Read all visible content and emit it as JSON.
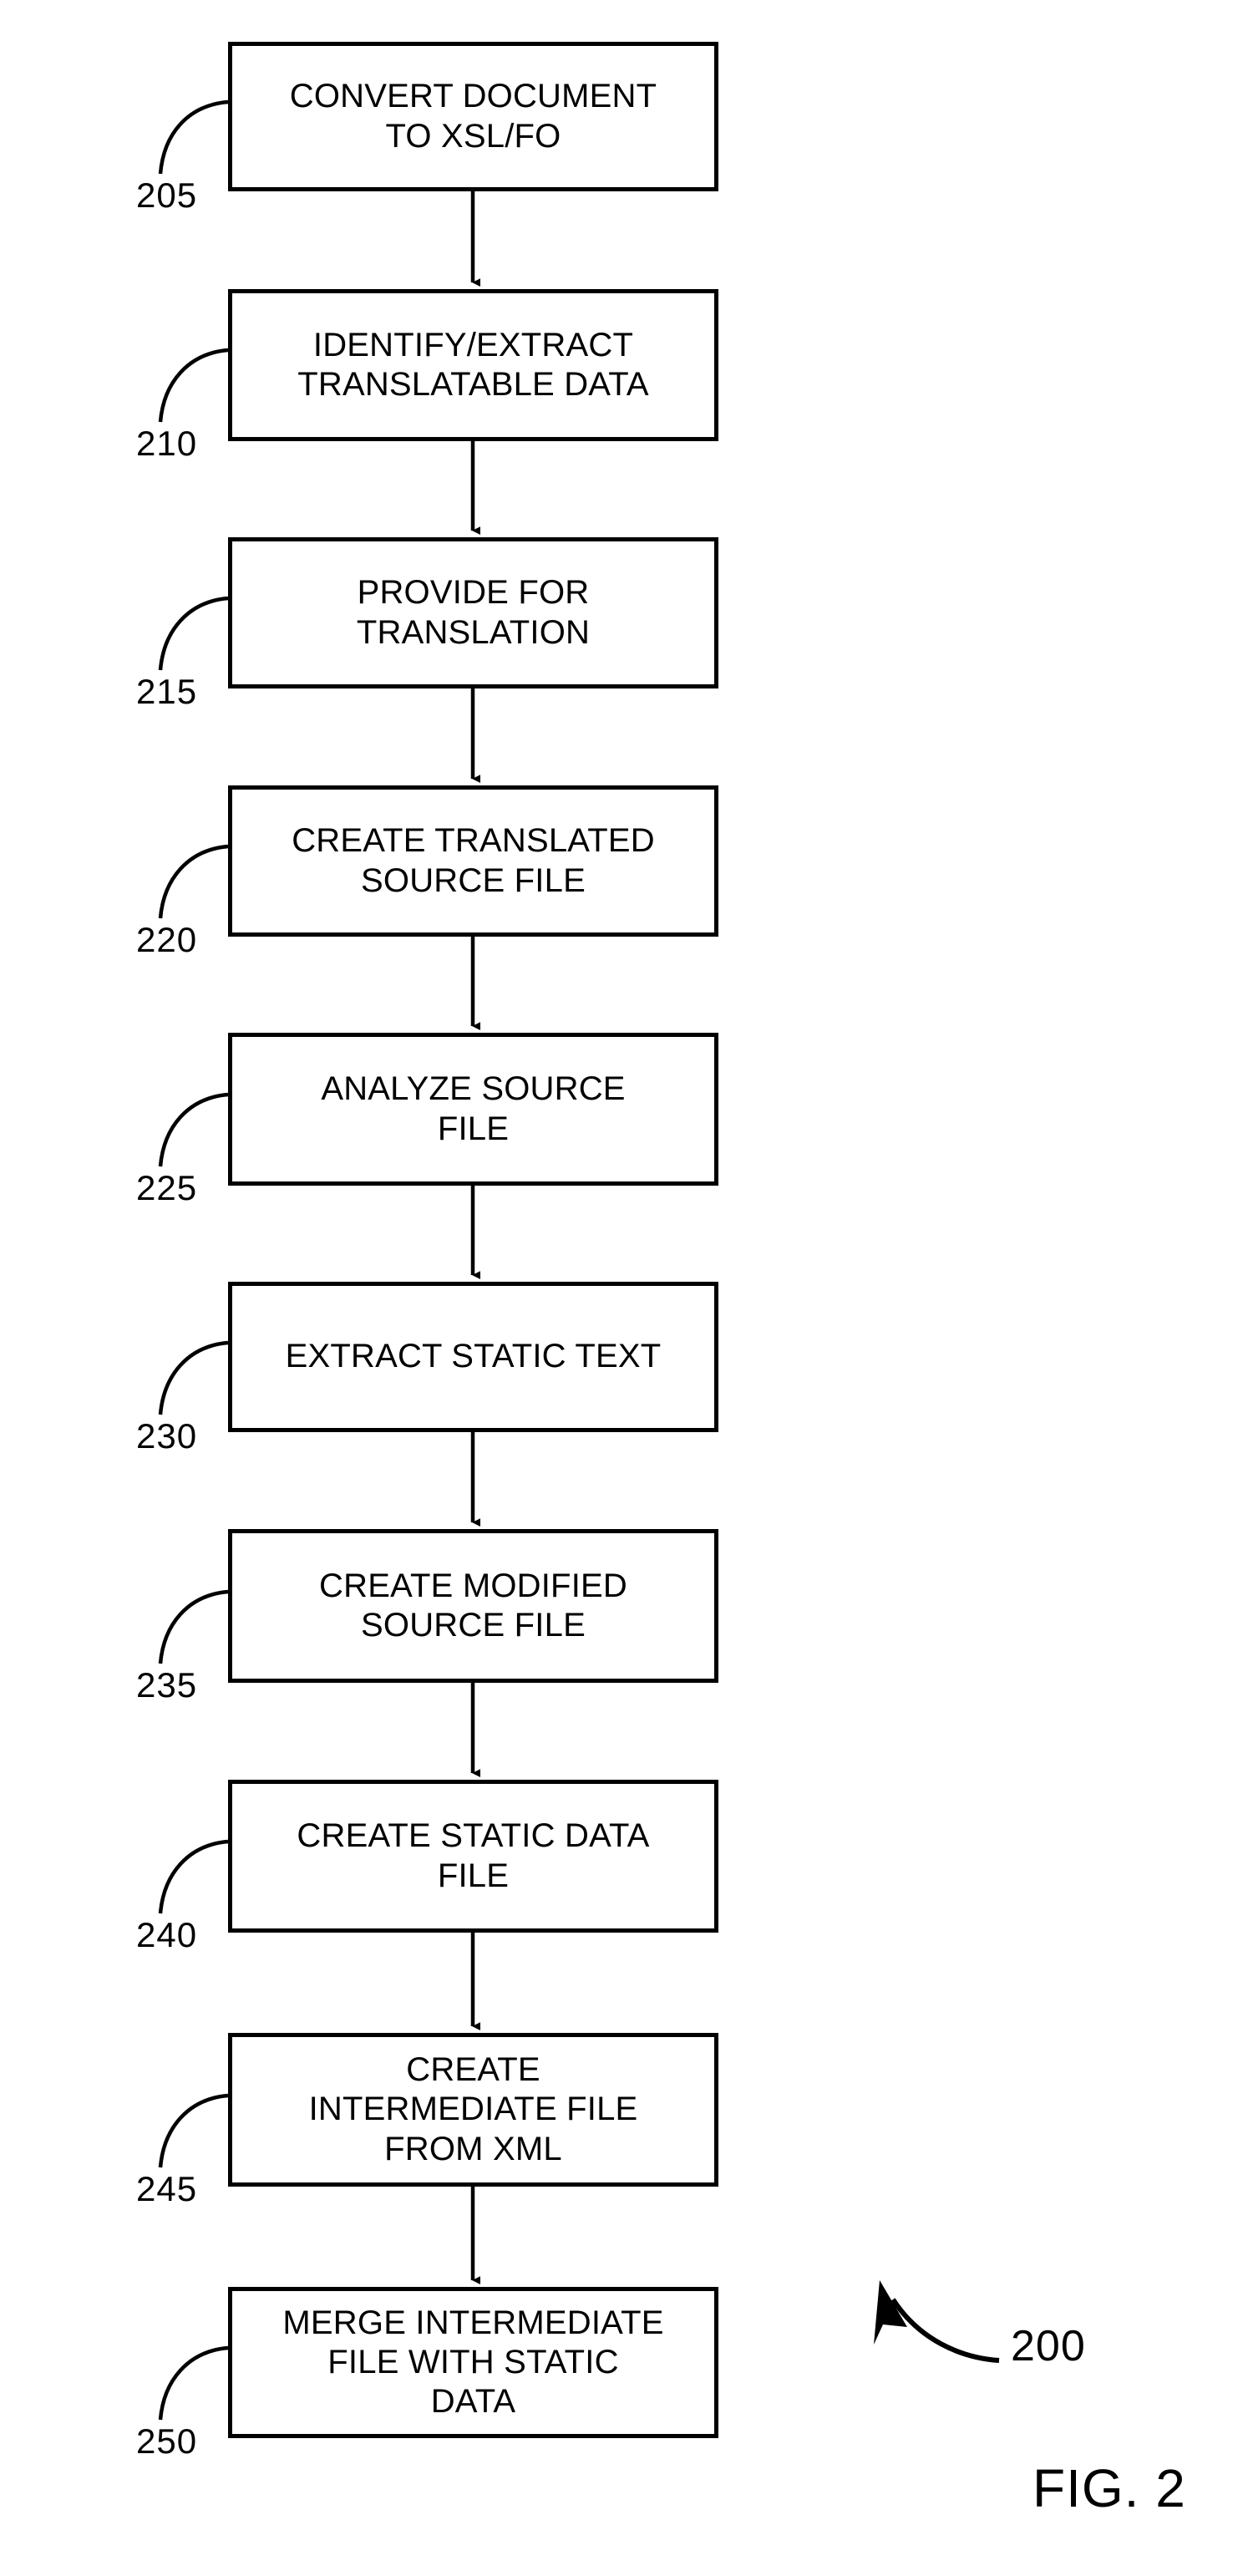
{
  "figure": {
    "caption": "FIG. 2",
    "diagram_ref": "200",
    "type": "patent-flowchart",
    "orientation": "vertical-top-to-bottom",
    "line_color": "#000000",
    "background_color": "#ffffff"
  },
  "steps": [
    {
      "ref": "205",
      "lines": [
        "CONVERT DOCUMENT",
        "TO XSL/FO"
      ],
      "text": "CONVERT DOCUMENT TO XSL/FO"
    },
    {
      "ref": "210",
      "lines": [
        "IDENTIFY/EXTRACT",
        "TRANSLATABLE DATA"
      ],
      "text": "IDENTIFY/EXTRACT TRANSLATABLE DATA"
    },
    {
      "ref": "215",
      "lines": [
        "PROVIDE FOR",
        "TRANSLATION"
      ],
      "text": "PROVIDE FOR TRANSLATION"
    },
    {
      "ref": "220",
      "lines": [
        "CREATE TRANSLATED",
        "SOURCE FILE"
      ],
      "text": "CREATE TRANSLATED SOURCE FILE"
    },
    {
      "ref": "225",
      "lines": [
        "ANALYZE SOURCE",
        "FILE"
      ],
      "text": "ANALYZE SOURCE FILE"
    },
    {
      "ref": "230",
      "lines": [
        "EXTRACT STATIC TEXT"
      ],
      "text": "EXTRACT STATIC TEXT"
    },
    {
      "ref": "235",
      "lines": [
        "CREATE MODIFIED",
        "SOURCE FILE"
      ],
      "text": "CREATE MODIFIED SOURCE FILE"
    },
    {
      "ref": "240",
      "lines": [
        "CREATE STATIC DATA",
        "FILE"
      ],
      "text": "CREATE STATIC DATA FILE"
    },
    {
      "ref": "245",
      "lines": [
        "CREATE",
        "INTERMEDIATE FILE",
        "FROM XML"
      ],
      "text": "CREATE INTERMEDIATE FILE FROM XML"
    },
    {
      "ref": "250",
      "lines": [
        "MERGE INTERMEDIATE",
        "FILE WITH STATIC",
        "DATA"
      ],
      "text": "MERGE INTERMEDIATE FILE WITH STATIC DATA"
    }
  ]
}
